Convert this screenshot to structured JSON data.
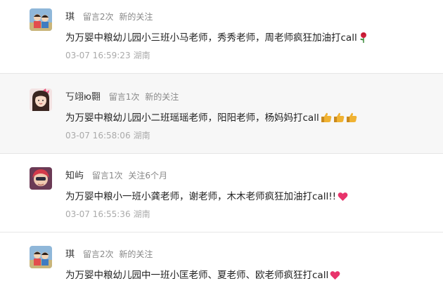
{
  "comments": [
    {
      "name": "琪",
      "count": "留言2次",
      "status": "新的关注",
      "text": "为万婴中粮幼儿园小三班小马老师，秀秀老师，周老师疯狂加油打call",
      "emoji": "rose-icon",
      "time": "03-07 16:59:23",
      "location": "湖南"
    },
    {
      "name": "丂翊ю翾",
      "count": "留言1次",
      "status": "新的关注",
      "text": "为万婴中粮幼儿园小二班瑶瑶老师，阳阳老师，杨妈妈打call",
      "emoji": "thumbs-up-icon",
      "time": "03-07 16:58:06",
      "location": "湖南"
    },
    {
      "name": "知屿",
      "count": "留言1次",
      "status": "关注6个月",
      "text": "为万婴中粮小一班小龚老师，谢老师，木木老师疯狂加油打call!!",
      "emoji": "heart-icon",
      "time": "03-07 16:55:36",
      "location": "湖南"
    },
    {
      "name": "琪",
      "count": "留言2次",
      "status": "新的关注",
      "text": "为万婴中粮幼儿园中一班小匡老师、夏老师、欧老师疯狂打call",
      "emoji": "heart-icon",
      "time": "",
      "location": ""
    }
  ],
  "colors": {
    "alt_background": "#f7f7f7",
    "divider": "#e6e6e6",
    "heart": "#e8336b",
    "rose": "#d0203a",
    "thumb": "#f0b232"
  }
}
